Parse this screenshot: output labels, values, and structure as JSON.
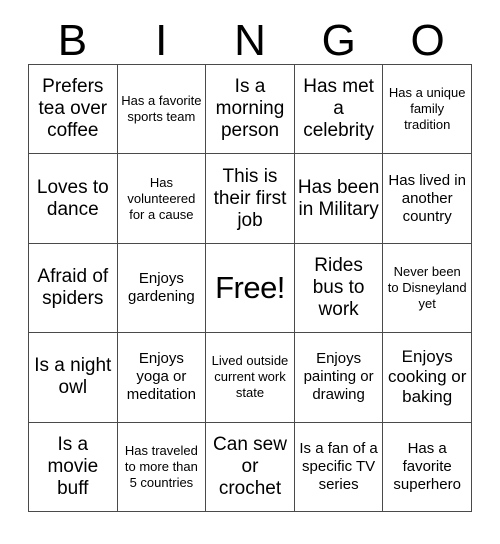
{
  "card": {
    "header_letters": [
      "B",
      "I",
      "N",
      "G",
      "O"
    ],
    "columns": 5,
    "rows": 5,
    "free_space_label": "Free!",
    "free_space_position": {
      "row": 3,
      "column": 3
    },
    "border_color": "#4a4a4a",
    "background_color": "#ffffff",
    "text_color": "#000000",
    "squares": [
      {
        "row": 1,
        "column": 1,
        "column_letter": "B",
        "text": "Prefers tea over coffee",
        "size": "lg"
      },
      {
        "row": 1,
        "column": 2,
        "column_letter": "I",
        "text": "Has a favorite sports team",
        "size": "xs"
      },
      {
        "row": 1,
        "column": 3,
        "column_letter": "N",
        "text": "Is a morning person",
        "size": "lg"
      },
      {
        "row": 1,
        "column": 4,
        "column_letter": "G",
        "text": "Has met a celebrity",
        "size": "lg"
      },
      {
        "row": 1,
        "column": 5,
        "column_letter": "O",
        "text": "Has a unique family tradition",
        "size": "xs"
      },
      {
        "row": 2,
        "column": 1,
        "column_letter": "B",
        "text": "Loves to dance",
        "size": "lg"
      },
      {
        "row": 2,
        "column": 2,
        "column_letter": "I",
        "text": "Has volunteered for a cause",
        "size": "xs"
      },
      {
        "row": 2,
        "column": 3,
        "column_letter": "N",
        "text": "This is their first job",
        "size": "lg"
      },
      {
        "row": 2,
        "column": 4,
        "column_letter": "G",
        "text": "Has been in Military",
        "size": "lg"
      },
      {
        "row": 2,
        "column": 5,
        "column_letter": "O",
        "text": "Has lived in another country",
        "size": "sm"
      },
      {
        "row": 3,
        "column": 1,
        "column_letter": "B",
        "text": "Afraid of spiders",
        "size": "lg"
      },
      {
        "row": 3,
        "column": 2,
        "column_letter": "I",
        "text": "Enjoys gardening",
        "size": "sm"
      },
      {
        "row": 3,
        "column": 3,
        "column_letter": "N",
        "text": "Free!",
        "size": "xl",
        "free": true
      },
      {
        "row": 3,
        "column": 4,
        "column_letter": "G",
        "text": "Rides bus to work",
        "size": "lg"
      },
      {
        "row": 3,
        "column": 5,
        "column_letter": "O",
        "text": "Never been to Disneyland yet",
        "size": "xs"
      },
      {
        "row": 4,
        "column": 1,
        "column_letter": "B",
        "text": "Is a night owl",
        "size": "lg"
      },
      {
        "row": 4,
        "column": 2,
        "column_letter": "I",
        "text": "Enjoys yoga or meditation",
        "size": "sm"
      },
      {
        "row": 4,
        "column": 3,
        "column_letter": "N",
        "text": "Lived outside current work state",
        "size": "xs"
      },
      {
        "row": 4,
        "column": 4,
        "column_letter": "G",
        "text": "Enjoys painting or drawing",
        "size": "sm"
      },
      {
        "row": 4,
        "column": 5,
        "column_letter": "O",
        "text": "Enjoys cooking or baking",
        "size": "md"
      },
      {
        "row": 5,
        "column": 1,
        "column_letter": "B",
        "text": "Is a movie buff",
        "size": "lg"
      },
      {
        "row": 5,
        "column": 2,
        "column_letter": "I",
        "text": "Has traveled to more than 5 countries",
        "size": "xs"
      },
      {
        "row": 5,
        "column": 3,
        "column_letter": "N",
        "text": "Can sew or crochet",
        "size": "lg"
      },
      {
        "row": 5,
        "column": 4,
        "column_letter": "G",
        "text": "Is a fan of a specific TV series",
        "size": "sm"
      },
      {
        "row": 5,
        "column": 5,
        "column_letter": "O",
        "text": "Has a favorite superhero",
        "size": "sm"
      }
    ]
  }
}
